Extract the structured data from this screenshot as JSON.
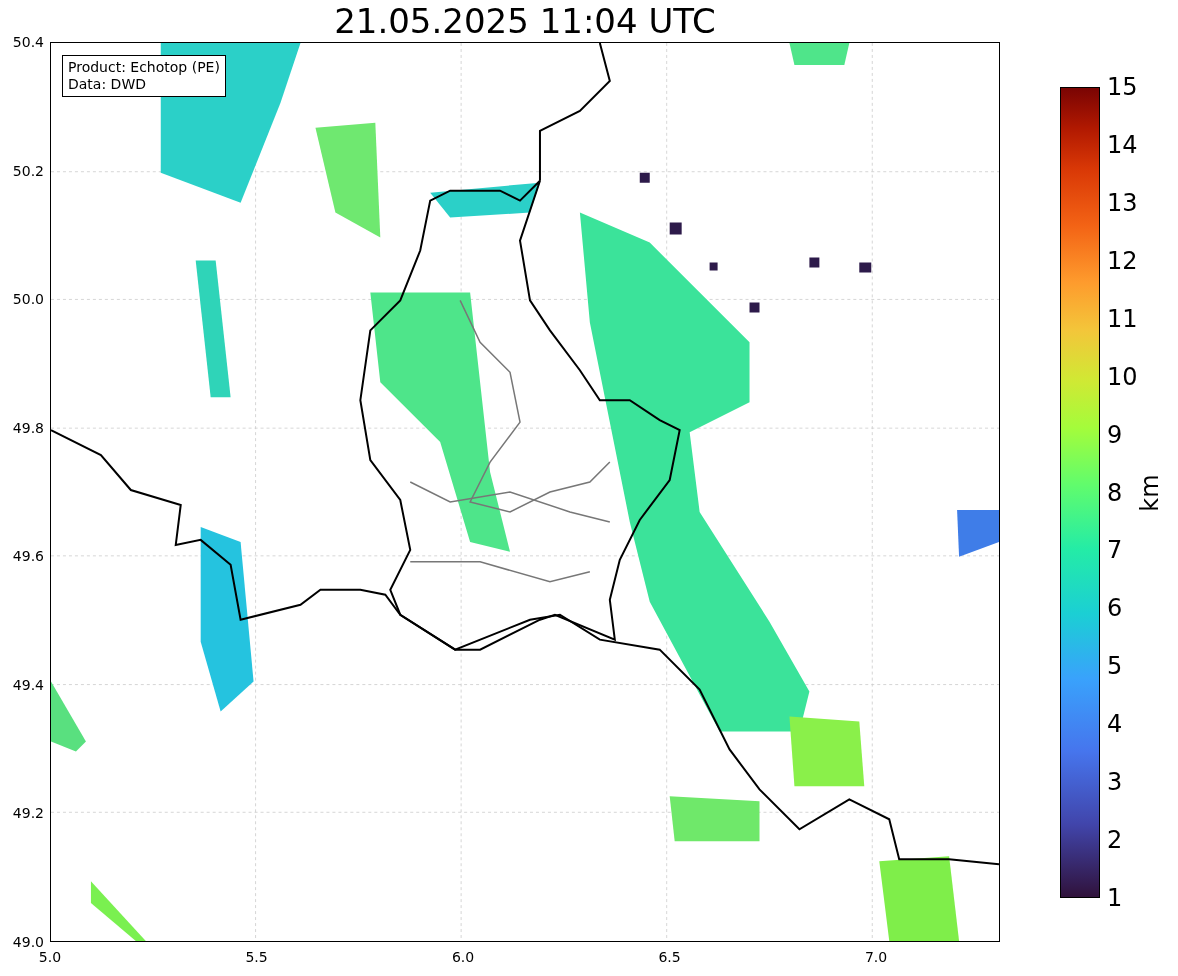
{
  "title": "21.05.2025 11:04 UTC",
  "info_box": [
    "Product: Echotop (PE)",
    "Data: DWD"
  ],
  "x_axis": {
    "ticks": [
      "5.0",
      "5.5",
      "6.0",
      "6.5",
      "7.0"
    ]
  },
  "y_axis": {
    "ticks": [
      "50.4",
      "50.2",
      "50.0",
      "49.8",
      "49.6",
      "49.4",
      "49.2",
      "49.0"
    ]
  },
  "colorbar": {
    "label": "km",
    "ticks": [
      "15",
      "14",
      "13",
      "12",
      "11",
      "10",
      "9",
      "8",
      "7",
      "6",
      "5",
      "4",
      "3",
      "2",
      "1"
    ]
  }
}
